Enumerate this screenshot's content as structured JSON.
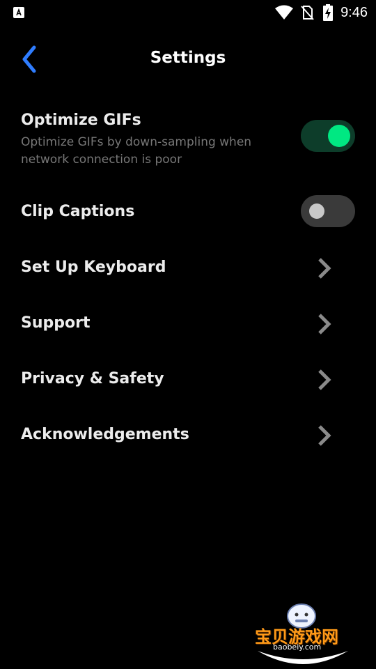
{
  "status_bar": {
    "time": "9:46",
    "icons": [
      "app-badge-icon",
      "wifi-icon",
      "no-sim-icon",
      "battery-charging-icon"
    ]
  },
  "header": {
    "title": "Settings",
    "back_icon": "chevron-left-icon"
  },
  "settings": {
    "optimize_gifs": {
      "label": "Optimize GIFs",
      "description": "Optimize GIFs by down-sampling when network connection is poor",
      "enabled": true
    },
    "clip_captions": {
      "label": "Clip Captions",
      "enabled": false
    },
    "nav_items": [
      {
        "label": "Set Up Keyboard"
      },
      {
        "label": "Support"
      },
      {
        "label": "Privacy & Safety"
      },
      {
        "label": "Acknowledgements"
      }
    ]
  },
  "watermark": {
    "brand": "宝贝游戏网",
    "site": "baobeiy.com"
  },
  "colors": {
    "background": "#000000",
    "accent_blue": "#2f7dff",
    "toggle_on_knob": "#00e882",
    "toggle_on_track": "#0d3d2a",
    "toggle_off_track": "#3a3a3a"
  }
}
